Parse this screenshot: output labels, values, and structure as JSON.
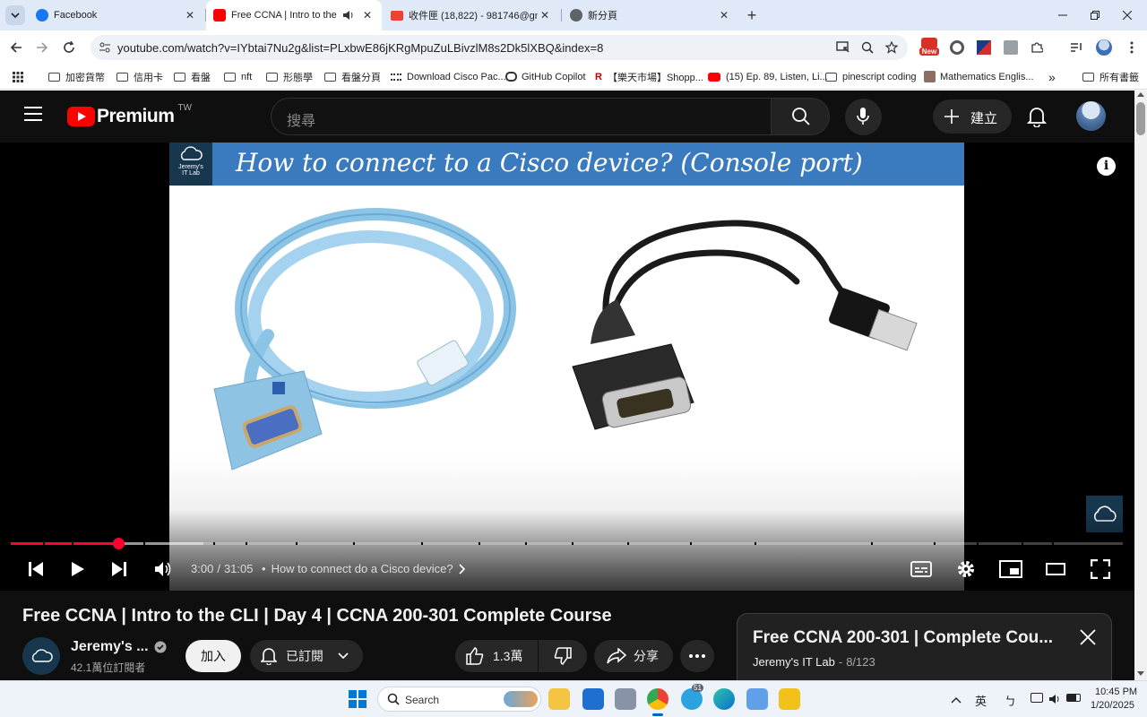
{
  "browser": {
    "tabs": [
      {
        "title": "Facebook",
        "color": "#1877f2",
        "active": false
      },
      {
        "title": "Free CCNA | Intro to the CLI",
        "color": "#ff0000",
        "active": true
      },
      {
        "title": "收件匣 (18,822) - 981746@gma",
        "color": "#ea4335",
        "active": false
      },
      {
        "title": "新分頁",
        "color": "#5f6368",
        "active": false
      }
    ],
    "new_tab_symbol": "+",
    "url": "youtube.com/watch?v=IYbtai7Nu2g&list=PLxbwE86jKRgMpuZuLBivzlM8s2Dk5lXBQ&index=8",
    "extension_badge": "New",
    "bookmarks": [
      {
        "label": "加密貨幣",
        "type": "folder"
      },
      {
        "label": "信用卡",
        "type": "folder"
      },
      {
        "label": "看盤",
        "type": "folder"
      },
      {
        "label": "nft",
        "type": "folder"
      },
      {
        "label": "形態學",
        "type": "folder"
      },
      {
        "label": "看盤分頁",
        "type": "folder"
      },
      {
        "label": "Download Cisco Pac...",
        "type": "link"
      },
      {
        "label": "GitHub Copilot",
        "type": "link"
      },
      {
        "label": "【樂天市場】Shopp...",
        "type": "link"
      },
      {
        "label": "(15) Ep. 89, Listen, Li...",
        "type": "link"
      },
      {
        "label": "pinescript coding",
        "type": "folder"
      },
      {
        "label": "Mathematics Englis...",
        "type": "link"
      }
    ],
    "bookmarks_more": "»",
    "all_bookmarks": "所有書籤"
  },
  "youtube": {
    "logo_text": "Premium",
    "region": "TW",
    "search_placeholder": "搜尋",
    "create_label": "建立",
    "video": {
      "slide_title": "How to connect to a Cisco device? (Console port)",
      "slide_logo_line1": "Jeremy's",
      "slide_logo_line2": "IT Lab",
      "time_current": "3:00",
      "time_separator": "/",
      "time_total": "31:05",
      "chapter_bullet": "•",
      "chapter": "How to connect do a Cisco device?",
      "progress_fraction": 0.0965,
      "buffered_fraction": 0.173
    },
    "title": "Free CCNA | Intro to the CLI | Day 4 | CCNA 200-301 Complete Course",
    "channel": {
      "name": "Jeremy's ...",
      "subscribers": "42.1萬位訂閱者",
      "join_label": "加入",
      "subscribed_label": "已訂閱"
    },
    "actions": {
      "likes": "1.3萬",
      "share": "分享"
    },
    "playlist": {
      "title": "Free CCNA 200-301 | Complete Cou...",
      "channel": "Jeremy's IT Lab",
      "separator": "-",
      "position": "8/123"
    }
  },
  "taskbar": {
    "search_placeholder": "Search",
    "tray_lang": "英",
    "tray_ime": "ㄅ",
    "time": "10:45 PM",
    "date": "1/20/2025",
    "notification_badge": "51"
  }
}
